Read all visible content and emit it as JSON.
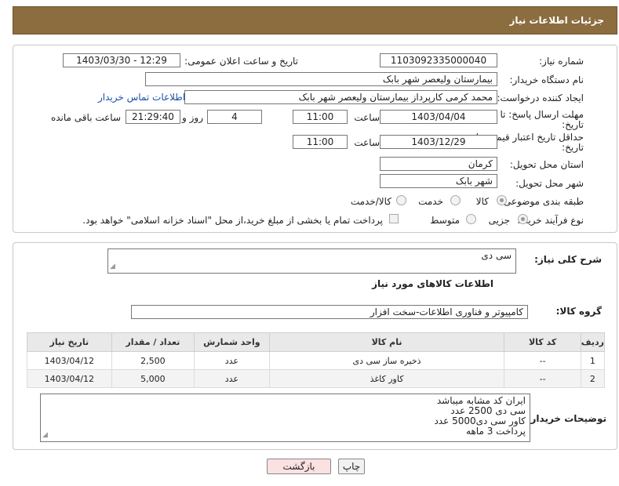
{
  "header": {
    "title": "جزئیات اطلاعات نیاز"
  },
  "fields": {
    "need_number_label": "شماره نیاز:",
    "need_number": "1103092335000040",
    "announce_label": "تاریخ و ساعت اعلان عمومی:",
    "announce_value": "1403/03/30 - 12:29",
    "buyer_org_label": "نام دستگاه خریدار:",
    "buyer_org": "بیمارستان ولیعصر شهر بابک",
    "creator_label": "ایجاد کننده درخواست:",
    "creator": "محمد  کرمی  کارپرداز  بیمارستان ولیعصر شهر بابک",
    "contact_link": "اطلاعات تماس خریدار",
    "deadline_label_1": "مهلت ارسال پاسخ: تا",
    "deadline_label_2": "تاریخ:",
    "deadline_date": "1403/04/04",
    "time_label": "ساعت",
    "deadline_time": "11:00",
    "days_value": "4",
    "days_label": "روز و",
    "remaining_value": "21:29:40",
    "remaining_label": "ساعت باقی مانده",
    "validity_label_1": "حداقل تاریخ اعتبار قیمت: تا",
    "validity_label_2": "تاریخ:",
    "validity_date": "1403/12/29",
    "validity_time": "11:00",
    "province_label": "استان محل تحویل:",
    "province": "کرمان",
    "city_label": "شهر محل تحویل:",
    "city": "شهر بابک",
    "category_label": "طبقه بندی موضوعی:",
    "category_options": [
      "کالا",
      "خدمت",
      "کالا/خدمت"
    ],
    "process_label": "نوع فرآیند خرید :",
    "process_options": [
      "جزیی",
      "متوسط"
    ],
    "payment_note": "پرداخت تمام یا بخشی از مبلغ خرید،از محل \"اسناد خزانه اسلامی\" خواهد بود."
  },
  "description": {
    "label": "شرح کلی نیاز:",
    "value": "سی دی"
  },
  "goods": {
    "section_title": "اطلاعات کالاهای مورد نیاز",
    "group_label": "گروه کالا:",
    "group_value": "کامپیوتر و فناوری اطلاعات-سخت افزار",
    "columns": [
      "ردیف",
      "کد کالا",
      "نام کالا",
      "واحد شمارش",
      "تعداد / مقدار",
      "تاریخ نیاز"
    ],
    "rows": [
      {
        "row": "1",
        "code": "--",
        "name": "ذخیره ساز سی دی",
        "unit": "عدد",
        "qty": "2,500",
        "date": "1403/04/12"
      },
      {
        "row": "2",
        "code": "--",
        "name": "کاور کاغذ",
        "unit": "عدد",
        "qty": "5,000",
        "date": "1403/04/12"
      }
    ]
  },
  "buyer_notes": {
    "label": "توضیحات خریدار:",
    "lines": [
      "ایران کد مشابه میباشد",
      "سی دی 2500 عدد",
      "کاور سی دی5000 عدد",
      "پرداخت 3 ماهه"
    ]
  },
  "buttons": {
    "print": "چاپ",
    "back": "بازگشت"
  }
}
